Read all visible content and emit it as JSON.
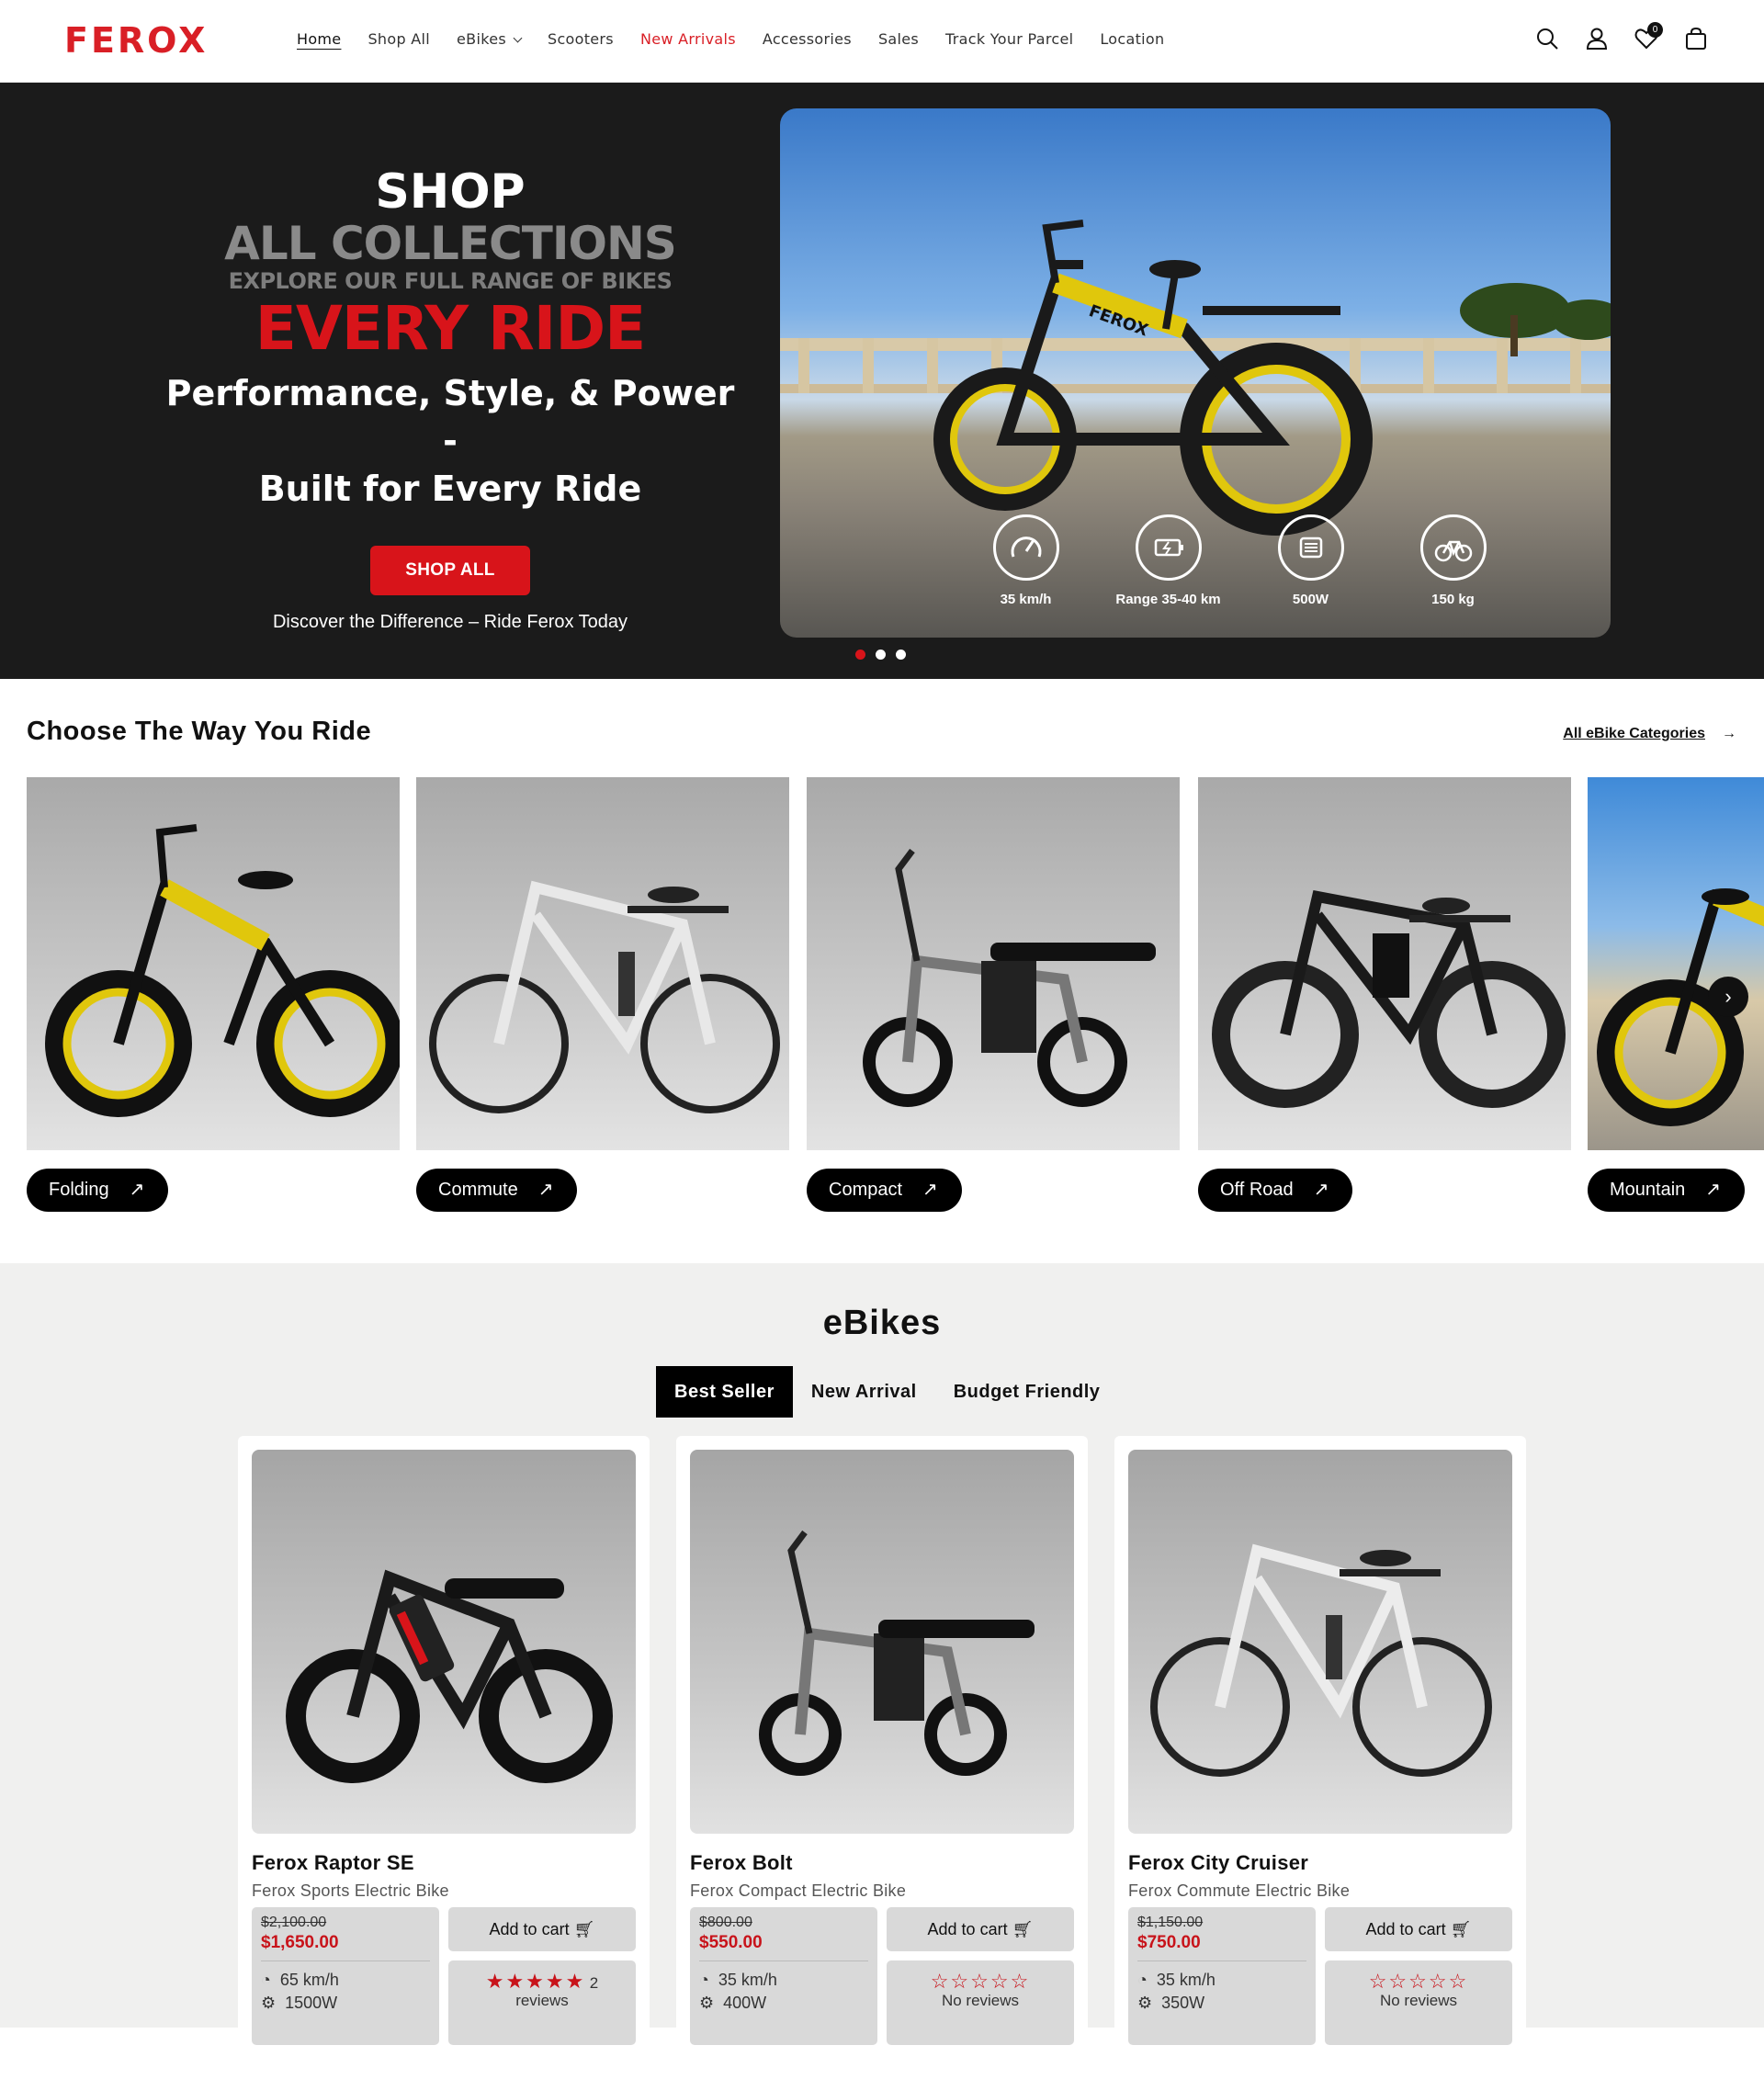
{
  "header": {
    "logo": "FEROX",
    "nav": [
      {
        "label": "Home"
      },
      {
        "label": "Shop All"
      },
      {
        "label": "eBikes"
      },
      {
        "label": "Scooters"
      },
      {
        "label": "New Arrivals"
      },
      {
        "label": "Accessories"
      },
      {
        "label": "Sales"
      },
      {
        "label": "Track Your Parcel"
      },
      {
        "label": "Location"
      }
    ],
    "wishlist_count": "0",
    "accent_color": "#d91f26"
  },
  "hero": {
    "line1": "SHOP",
    "line2": "ALL COLLECTIONS",
    "line3": "EXPLORE OUR FULL RANGE OF BIKES",
    "line4": "EVERY RIDE",
    "line5a": "Performance, Style, & Power -",
    "line5b": "Built for Every Ride",
    "button": "SHOP ALL",
    "tagline": "Discover the Difference – Ride Ferox Today",
    "bike_brand": "FEROX",
    "specs": [
      {
        "icon": "speedometer-icon",
        "label": "35 km/h"
      },
      {
        "icon": "battery-range-icon",
        "label": "Range 35-40 km"
      },
      {
        "icon": "motor-icon",
        "label": "500W"
      },
      {
        "icon": "bicycle-icon",
        "label": "150 kg"
      }
    ]
  },
  "categories": {
    "title": "Choose The Way You Ride",
    "link": "All eBike Categories",
    "items": [
      {
        "label": "Folding"
      },
      {
        "label": "Commute"
      },
      {
        "label": "Compact"
      },
      {
        "label": "Off Road"
      },
      {
        "label": "Mountain"
      }
    ]
  },
  "ebikes": {
    "title": "eBikes",
    "tabs": [
      "Best Seller",
      "New Arrival",
      "Budget Friendly"
    ],
    "add_to_cart": "Add to cart",
    "products": [
      {
        "name": "Ferox Raptor SE",
        "subtitle": "Ferox Sports Electric Bike",
        "old_price": "$2,100.00",
        "price": "$1,650.00",
        "speed": "65 km/h",
        "stars": "★★★★★",
        "review_count": "2",
        "review_label": "reviews",
        "power": "1500W"
      },
      {
        "name": "Ferox Bolt",
        "subtitle": "Ferox Compact Electric Bike",
        "old_price": "$800.00",
        "price": "$550.00",
        "speed": "35 km/h",
        "stars": "☆☆☆☆☆",
        "review_count": "",
        "review_label": "No reviews",
        "power": "400W"
      },
      {
        "name": "Ferox City Cruiser",
        "subtitle": "Ferox Commute Electric Bike",
        "old_price": "$1,150.00",
        "price": "$750.00",
        "speed": "35 km/h",
        "stars": "☆☆☆☆☆",
        "review_count": "",
        "review_label": "No reviews",
        "power": "350W"
      }
    ]
  }
}
